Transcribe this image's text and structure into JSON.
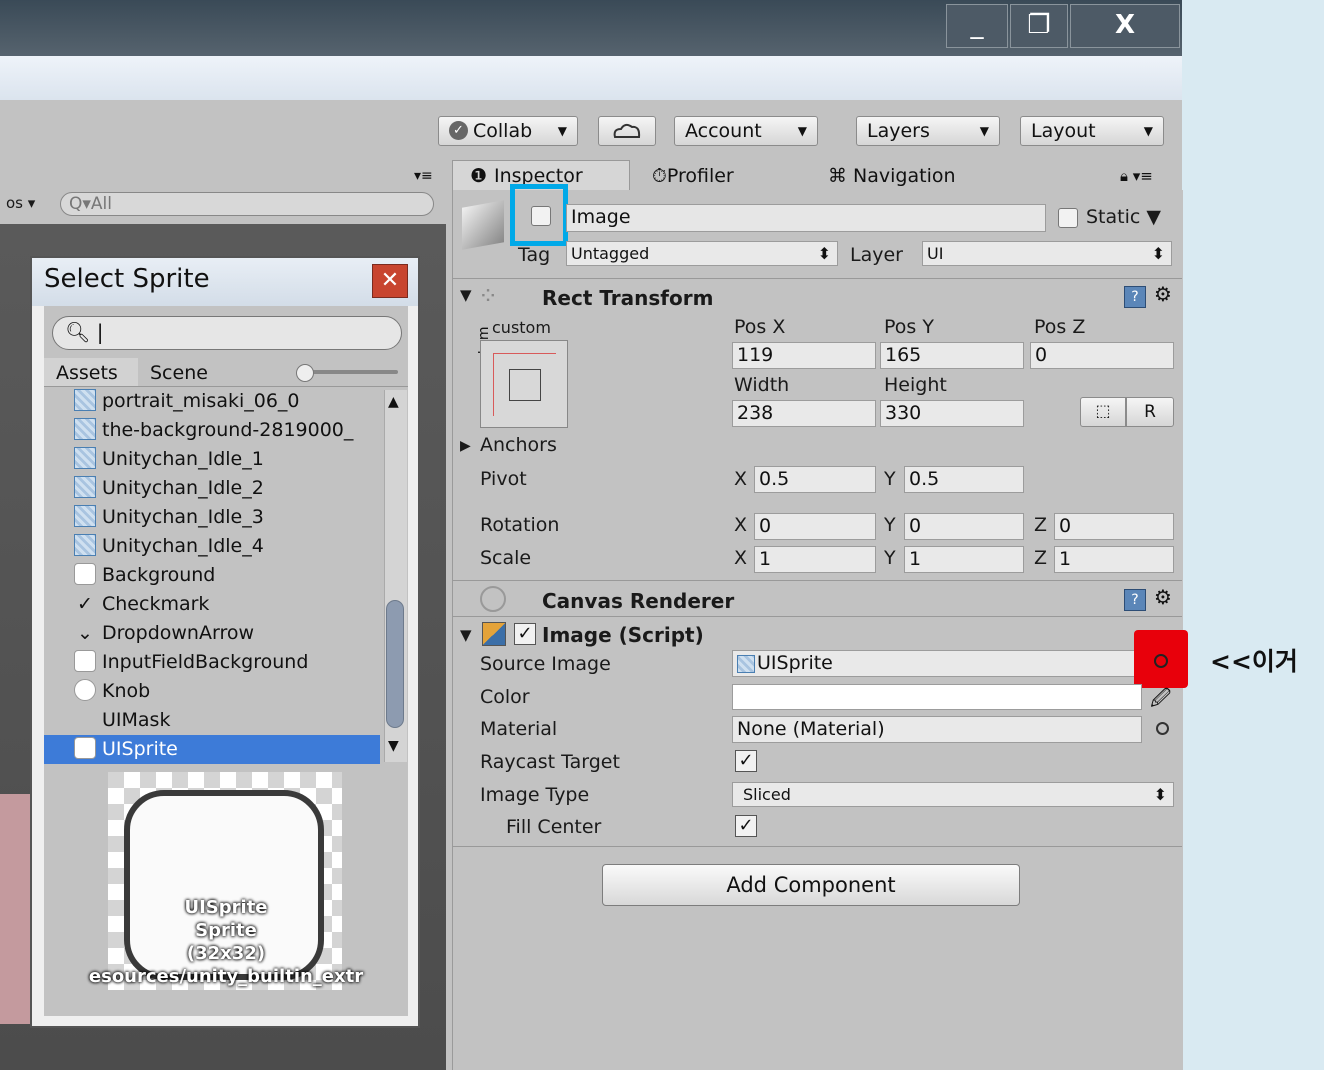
{
  "window": {
    "minimize": "_",
    "maximize": "❐",
    "close": "X"
  },
  "toolbar": {
    "collab": "Collab",
    "account": "Account",
    "layers": "Layers",
    "layout": "Layout",
    "cloud_icon": "cloud-icon"
  },
  "tabs": {
    "inspector": "Inspector",
    "profiler": "Profiler",
    "navigation": "Navigation"
  },
  "hierarchy": {
    "dropdown": "os",
    "search_placeholder": "All"
  },
  "select_sprite": {
    "title": "Select Sprite",
    "tab_assets": "Assets",
    "tab_scene": "Scene",
    "items": [
      {
        "label": "portrait_misaki_06_0",
        "icon": "sprite"
      },
      {
        "label": "the-background-2819000_",
        "icon": "sprite"
      },
      {
        "label": "Unitychan_Idle_1",
        "icon": "sprite"
      },
      {
        "label": "Unitychan_Idle_2",
        "icon": "sprite"
      },
      {
        "label": "Unitychan_Idle_3",
        "icon": "sprite"
      },
      {
        "label": "Unitychan_Idle_4",
        "icon": "sprite"
      },
      {
        "label": "Background",
        "icon": "box"
      },
      {
        "label": "Checkmark",
        "icon": "check"
      },
      {
        "label": "DropdownArrow",
        "icon": "chevron"
      },
      {
        "label": "InputFieldBackground",
        "icon": "box"
      },
      {
        "label": "Knob",
        "icon": "circle"
      },
      {
        "label": "UIMask",
        "icon": "none"
      },
      {
        "label": "UISprite",
        "icon": "box",
        "selected": true
      }
    ],
    "preview": {
      "line1": "UISprite",
      "line2": "Sprite",
      "line3": "(32x32)",
      "line4": "esources/unity_builtin_extr"
    }
  },
  "object": {
    "name": "Image",
    "static_label": "Static",
    "tag_label": "Tag",
    "tag_value": "Untagged",
    "layer_label": "Layer",
    "layer_value": "UI"
  },
  "rect_transform": {
    "title": "Rect Transform",
    "anchor_preset": "custom",
    "anchor_side": "custom",
    "pos_x_label": "Pos X",
    "pos_y_label": "Pos Y",
    "pos_z_label": "Pos Z",
    "pos_x": "119",
    "pos_y": "165",
    "pos_z": "0",
    "width_label": "Width",
    "height_label": "Height",
    "width": "238",
    "height": "330",
    "r_button": "R",
    "anchors_label": "Anchors",
    "pivot_label": "Pivot",
    "pivot_x": "0.5",
    "pivot_y": "0.5",
    "rotation_label": "Rotation",
    "rot_x": "0",
    "rot_y": "0",
    "rot_z": "0",
    "scale_label": "Scale",
    "scale_x": "1",
    "scale_y": "1",
    "scale_z": "1",
    "x": "X",
    "y": "Y",
    "z": "Z"
  },
  "canvas_renderer": {
    "title": "Canvas Renderer"
  },
  "image_script": {
    "title": "Image (Script)",
    "source_image_label": "Source Image",
    "source_image_value": "UISprite",
    "color_label": "Color",
    "material_label": "Material",
    "material_value": "None (Material)",
    "raycast_label": "Raycast Target",
    "image_type_label": "Image Type",
    "image_type_value": "Sliced",
    "fill_center_label": "Fill Center"
  },
  "add_component": "Add Component",
  "annotation": "<<이거",
  "colors": {
    "highlight_blue": "#00a9e8",
    "highlight_red": "#e8000b",
    "selection": "#3d7bd8"
  }
}
